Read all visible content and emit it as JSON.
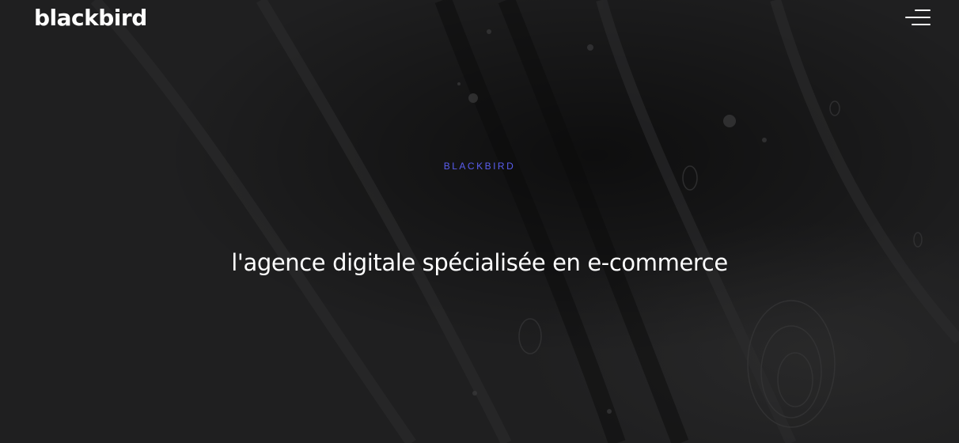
{
  "header": {
    "logo_text": "blackbird",
    "menu_icon": "hamburger-menu-icon"
  },
  "hero": {
    "eyebrow": "BLACKBIRD",
    "headline": "l'agence digitale spécialisée en e-commerce"
  },
  "colors": {
    "background": "#1e1e1f",
    "accent": "#5a5ef0",
    "text": "#ffffff"
  }
}
